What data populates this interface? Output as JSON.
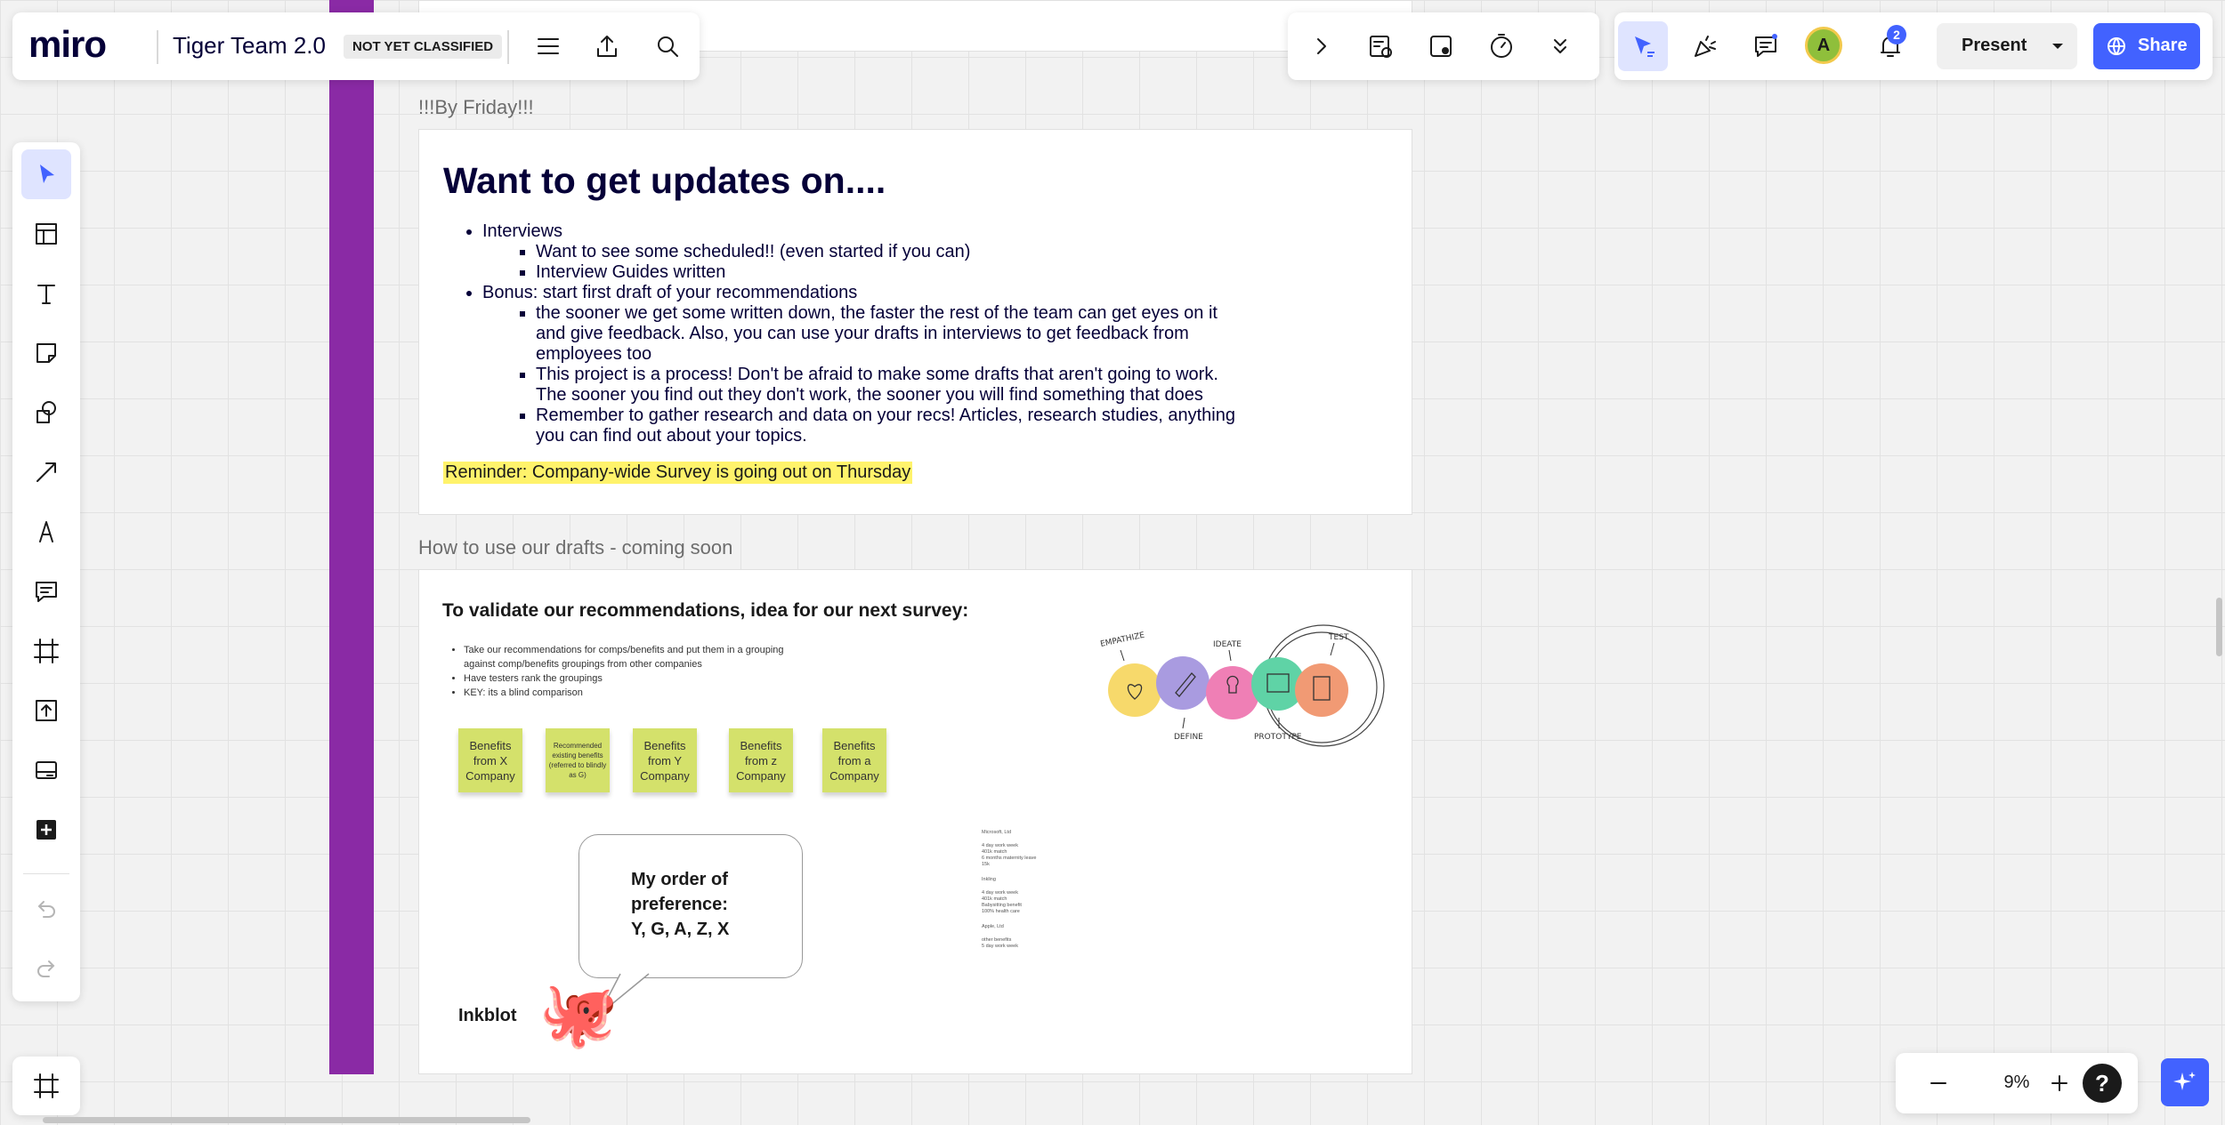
{
  "app": {
    "logo": "miro",
    "board_title": "Tiger Team 2.0",
    "classification": "NOT YET CLASSIFIED"
  },
  "toolbar_right": {
    "present_label": "Present",
    "share_label": "Share",
    "avatar_initial": "A",
    "notification_count": "2"
  },
  "zoom": {
    "level": "9%",
    "help_label": "?"
  },
  "canvas": {
    "frame1_label": "!!!By Friday!!!",
    "updates": {
      "title": "Want to get updates on....",
      "item1": "Interviews",
      "item1_sub1": "Want to see some scheduled!! (even started if you can)",
      "item1_sub2": "Interview Guides written",
      "item2": "Bonus: start first draft of your recommendations",
      "item2_sub1": "the sooner we get some written down, the faster the rest of the team can get eyes on it and give feedback. Also, you can use your drafts in interviews to get feedback from employees too",
      "item2_sub2": "This project is a process! Don't be afraid to make some drafts that aren't going to work. The sooner you find out they don't work, the sooner you will find something that does",
      "item2_sub3": "Remember to gather research and data on your recs! Articles, research studies, anything you can find out about your topics.",
      "reminder": "Reminder: Company-wide Survey is going out on Thursday"
    },
    "frame2_label": "How to use our drafts - coming soon",
    "validate": {
      "title": "To validate our recommendations, idea for our next survey:",
      "bullet1": "Take our recommendations for comps/benefits and put them in a grouping against comp/benefits groupings from other companies",
      "bullet2": "Have testers rank the groupings",
      "bullet3": "KEY: its a blind comparison"
    },
    "stickies": [
      "Benefits from X Company",
      "Recommended existing benefits (referred to blindly as G)",
      "Benefits from Y Company",
      "Benefits from z Company",
      "Benefits from a Company"
    ],
    "bubble": {
      "line1": "My order of",
      "line2": "preference:",
      "line3": "Y, G, A, Z, X"
    },
    "inkblot_label": "Inkblot",
    "octopus": "🐙",
    "tiny_notes": [
      "Microsoft, Ltd",
      "4 day work week",
      "401k match",
      "6 months maternity leave",
      "15k",
      "Inkling",
      "4 day work week",
      "401k match",
      "Babysitting benefit",
      "100% health care",
      "Apple, Ltd",
      "other benefits",
      "5 day work week"
    ],
    "diagram_labels": {
      "empathize": "EMPATHIZE",
      "define": "DEFINE",
      "ideate": "IDEATE",
      "prototype": "PROTOTYPE",
      "test": "TEST"
    }
  },
  "colors": {
    "accent": "#4262ff",
    "purple_bar": "#8a2aa5",
    "sticky": "#d4e16b",
    "highlight": "#fff36b",
    "empathize": "#f7d96b",
    "define": "#a99be0",
    "ideate": "#ef7fb5",
    "prototype": "#5fd3a6",
    "test": "#f19a74"
  }
}
